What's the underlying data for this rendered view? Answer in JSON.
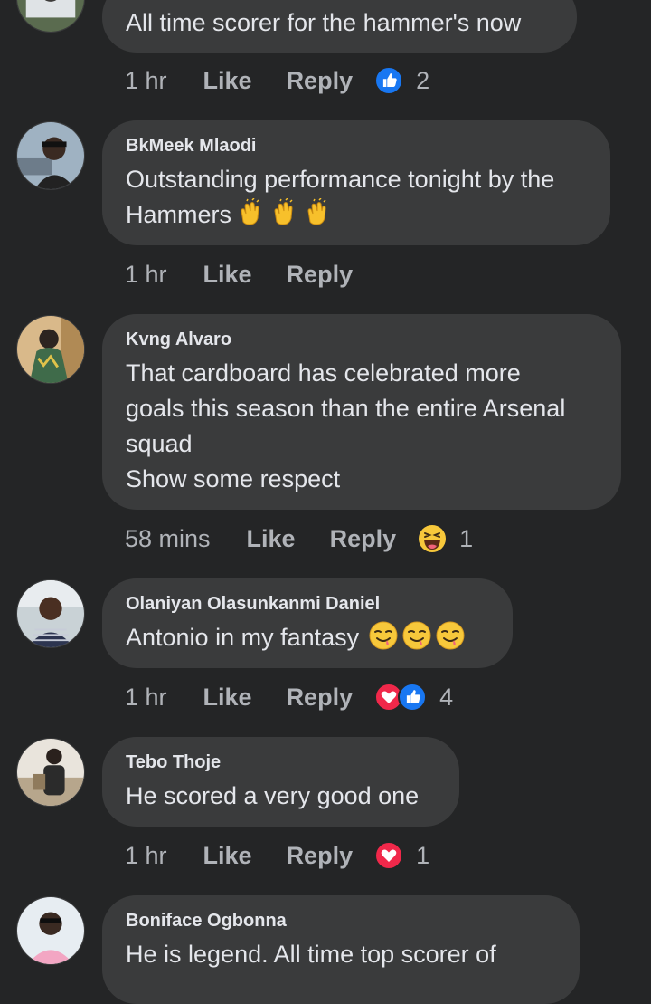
{
  "comments": [
    {
      "name": "",
      "text": "All time scorer for the hammer's now",
      "time": "1 hr",
      "like": "Like",
      "reply": "Reply",
      "reaction_count": "2",
      "reactions": [
        "like-icon"
      ]
    },
    {
      "name": "BkMeek Mlaodi",
      "text": "Outstanding performance tonight by the\nHammers",
      "emojis": [
        "clapping-hands-icon",
        "clapping-hands-icon",
        "clapping-hands-icon"
      ],
      "time": "1 hr",
      "like": "Like",
      "reply": "Reply"
    },
    {
      "name": "Kvng Alvaro",
      "text": "That cardboard has celebrated more\ngoals this season than the entire Arsenal\nsquad\nShow some respect",
      "time": "58 mins",
      "like": "Like",
      "reply": "Reply",
      "reaction_count": "1",
      "reactions": [
        "haha-icon"
      ]
    },
    {
      "name": "Olaniyan Olasunkanmi Daniel",
      "text": "Antonio in my fantasy",
      "emojis": [
        "smirk-face-icon",
        "smirk-face-icon",
        "smirk-face-icon"
      ],
      "time": "1 hr",
      "like": "Like",
      "reply": "Reply",
      "reaction_count": "4",
      "reactions": [
        "love-icon",
        "like-icon"
      ]
    },
    {
      "name": "Tebo Thoje",
      "text": "He scored a very good one",
      "time": "1 hr",
      "like": "Like",
      "reply": "Reply",
      "reaction_count": "1",
      "reactions": [
        "love-icon"
      ]
    },
    {
      "name": "Boniface Ogbonna",
      "text": "He is legend. All time top scorer of"
    }
  ],
  "colors": {
    "background": "#242526",
    "bubble": "#3a3b3c",
    "text": "#e4e6eb",
    "meta": "#b0b3b8",
    "like_blue": "#1877f2",
    "love_red": "#f0284a"
  }
}
